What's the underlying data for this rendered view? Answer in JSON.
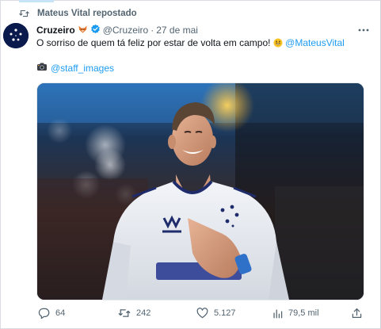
{
  "repost": {
    "label": "Mateus Vital repostado",
    "icon": "repost-icon"
  },
  "tweet": {
    "author_name": "Cruzeiro",
    "author_handle": "@Cruzeiro",
    "separator": "·",
    "date": "27 de mai",
    "text": "O sorriso de quem tá feliz por estar de volta em campo! ",
    "mention": "@MateusVital",
    "photo_credit": "@staff_images",
    "verified_color": "#1d9bf0",
    "link_color": "#1d9bf0"
  },
  "actions": {
    "replies": "64",
    "reposts": "242",
    "likes": "5.127",
    "views": "79,5 mil"
  }
}
